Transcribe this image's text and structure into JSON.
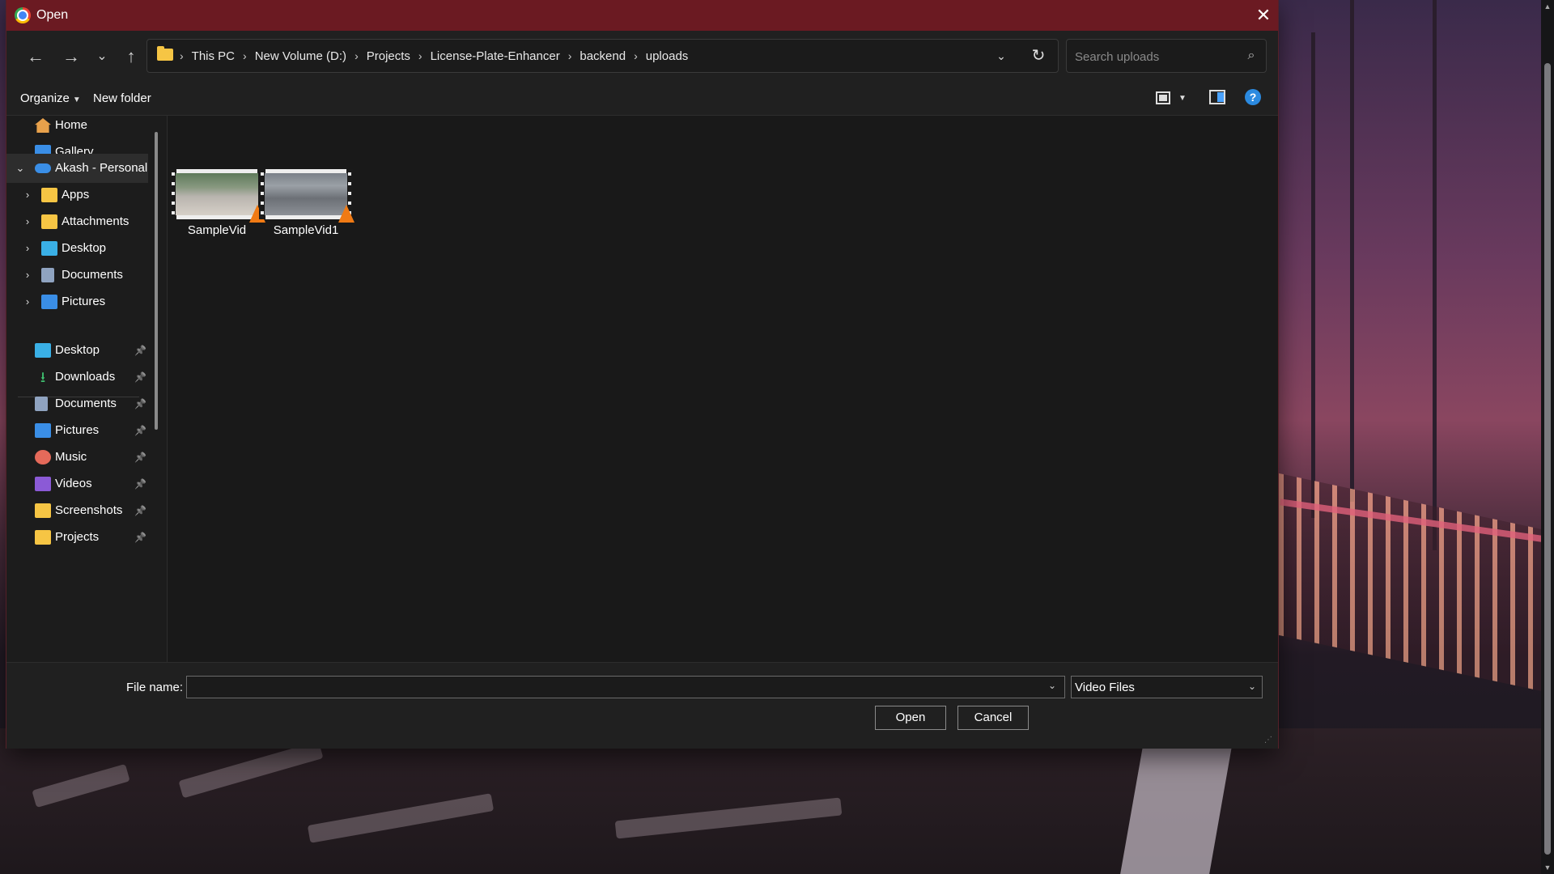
{
  "window": {
    "title": "Open",
    "close_glyph": "✕"
  },
  "nav": {
    "back": "←",
    "forward": "→",
    "recent": "⌄",
    "up": "↑"
  },
  "breadcrumb": [
    "This PC",
    "New Volume (D:)",
    "Projects",
    "License-Plate-Enhancer",
    "backend",
    "uploads"
  ],
  "breadcrumb_sep": "›",
  "search": {
    "placeholder": "Search uploads",
    "icon": "search-icon"
  },
  "toolbar": {
    "organize": "Organize",
    "new_folder": "New folder",
    "help": "?"
  },
  "sidebar": {
    "quick": [
      {
        "label": "Home",
        "icon": "home-icon"
      },
      {
        "label": "Gallery",
        "icon": "gallery-icon"
      }
    ],
    "onedrive": {
      "label": "Akash - Personal",
      "icon": "cloud-icon",
      "expanded": true
    },
    "onedrive_children": [
      {
        "label": "Apps",
        "icon": "folder-icon"
      },
      {
        "label": "Attachments",
        "icon": "folder-icon"
      },
      {
        "label": "Desktop",
        "icon": "desktop-icon"
      },
      {
        "label": "Documents",
        "icon": "document-icon"
      },
      {
        "label": "Pictures",
        "icon": "pictures-icon"
      }
    ],
    "pinned": [
      {
        "label": "Desktop",
        "icon": "desktop-icon"
      },
      {
        "label": "Downloads",
        "icon": "download-icon"
      },
      {
        "label": "Documents",
        "icon": "document-icon"
      },
      {
        "label": "Pictures",
        "icon": "pictures-icon"
      },
      {
        "label": "Music",
        "icon": "music-icon"
      },
      {
        "label": "Videos",
        "icon": "video-icon"
      },
      {
        "label": "Screenshots",
        "icon": "folder-icon"
      },
      {
        "label": "Projects",
        "icon": "folder-icon"
      }
    ]
  },
  "files": [
    {
      "name": "SampleVid",
      "type": "video",
      "thumb": "street-scene"
    },
    {
      "name": "SampleVid1",
      "type": "video",
      "thumb": "road-scene"
    }
  ],
  "bottom": {
    "file_name_label": "File name:",
    "file_name_value": "",
    "file_type": "Video Files",
    "open_label": "Open",
    "cancel_label": "Cancel"
  },
  "colors": {
    "titlebar": "#6b1a22",
    "dialog_bg": "#191919",
    "accent": "#2b8ae0",
    "folder": "#f6c544"
  }
}
